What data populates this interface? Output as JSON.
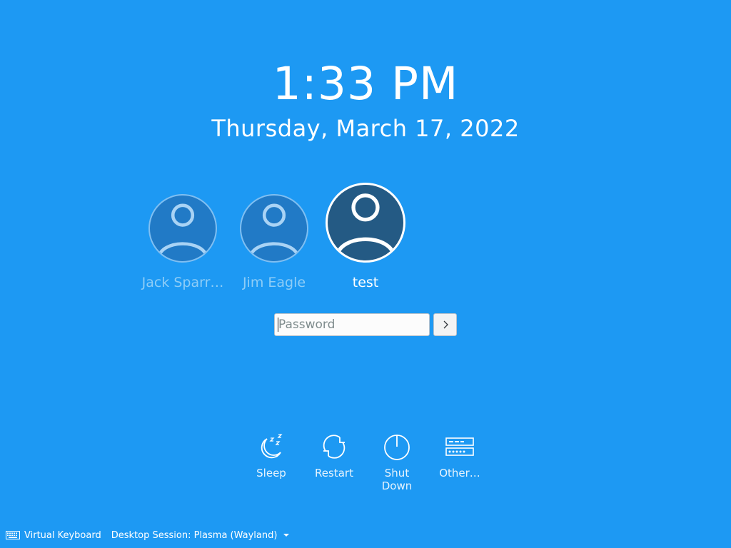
{
  "clock": {
    "time": "1:33 PM",
    "date": "Thursday, March 17, 2022"
  },
  "users": [
    {
      "name": "Jack Sparr…",
      "icon": "user-avatar-icon",
      "selected": false
    },
    {
      "name": "Jim Eagle",
      "icon": "user-avatar-icon",
      "selected": false
    },
    {
      "name": "test",
      "icon": "user-avatar-icon",
      "selected": true
    }
  ],
  "login": {
    "password_placeholder": "Password",
    "password_value": "",
    "submit_icon": "chevron-right-icon"
  },
  "actions": [
    {
      "label": "Sleep",
      "icon": "sleep-moon-icon"
    },
    {
      "label": "Restart",
      "icon": "restart-icon"
    },
    {
      "label": "Shut Down",
      "icon": "power-icon"
    },
    {
      "label": "Other…",
      "icon": "switch-user-icon"
    }
  ],
  "bottom_bar": {
    "virtual_keyboard_label": "Virtual Keyboard",
    "virtual_keyboard_icon": "keyboard-icon",
    "session_label": "Desktop Session: Plasma (Wayland)",
    "session_icon": "dropdown-arrow-icon"
  },
  "colors": {
    "background": "#1d99f3",
    "active_avatar": "#245a84",
    "inactive_avatar": "#217ac6",
    "inactive_text": "#8ecdf7"
  }
}
